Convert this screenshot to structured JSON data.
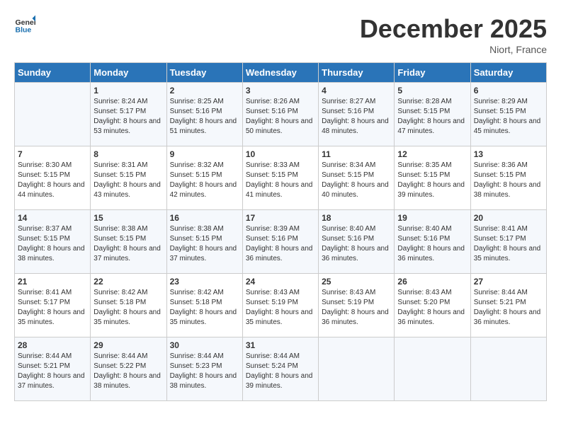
{
  "header": {
    "logo_general": "General",
    "logo_blue": "Blue",
    "month_title": "December 2025",
    "location": "Niort, France"
  },
  "days_of_week": [
    "Sunday",
    "Monday",
    "Tuesday",
    "Wednesday",
    "Thursday",
    "Friday",
    "Saturday"
  ],
  "weeks": [
    [
      {
        "day": "",
        "sunrise": "",
        "sunset": "",
        "daylight": ""
      },
      {
        "day": "1",
        "sunrise": "Sunrise: 8:24 AM",
        "sunset": "Sunset: 5:17 PM",
        "daylight": "Daylight: 8 hours and 53 minutes."
      },
      {
        "day": "2",
        "sunrise": "Sunrise: 8:25 AM",
        "sunset": "Sunset: 5:16 PM",
        "daylight": "Daylight: 8 hours and 51 minutes."
      },
      {
        "day": "3",
        "sunrise": "Sunrise: 8:26 AM",
        "sunset": "Sunset: 5:16 PM",
        "daylight": "Daylight: 8 hours and 50 minutes."
      },
      {
        "day": "4",
        "sunrise": "Sunrise: 8:27 AM",
        "sunset": "Sunset: 5:16 PM",
        "daylight": "Daylight: 8 hours and 48 minutes."
      },
      {
        "day": "5",
        "sunrise": "Sunrise: 8:28 AM",
        "sunset": "Sunset: 5:15 PM",
        "daylight": "Daylight: 8 hours and 47 minutes."
      },
      {
        "day": "6",
        "sunrise": "Sunrise: 8:29 AM",
        "sunset": "Sunset: 5:15 PM",
        "daylight": "Daylight: 8 hours and 45 minutes."
      }
    ],
    [
      {
        "day": "7",
        "sunrise": "Sunrise: 8:30 AM",
        "sunset": "Sunset: 5:15 PM",
        "daylight": "Daylight: 8 hours and 44 minutes."
      },
      {
        "day": "8",
        "sunrise": "Sunrise: 8:31 AM",
        "sunset": "Sunset: 5:15 PM",
        "daylight": "Daylight: 8 hours and 43 minutes."
      },
      {
        "day": "9",
        "sunrise": "Sunrise: 8:32 AM",
        "sunset": "Sunset: 5:15 PM",
        "daylight": "Daylight: 8 hours and 42 minutes."
      },
      {
        "day": "10",
        "sunrise": "Sunrise: 8:33 AM",
        "sunset": "Sunset: 5:15 PM",
        "daylight": "Daylight: 8 hours and 41 minutes."
      },
      {
        "day": "11",
        "sunrise": "Sunrise: 8:34 AM",
        "sunset": "Sunset: 5:15 PM",
        "daylight": "Daylight: 8 hours and 40 minutes."
      },
      {
        "day": "12",
        "sunrise": "Sunrise: 8:35 AM",
        "sunset": "Sunset: 5:15 PM",
        "daylight": "Daylight: 8 hours and 39 minutes."
      },
      {
        "day": "13",
        "sunrise": "Sunrise: 8:36 AM",
        "sunset": "Sunset: 5:15 PM",
        "daylight": "Daylight: 8 hours and 38 minutes."
      }
    ],
    [
      {
        "day": "14",
        "sunrise": "Sunrise: 8:37 AM",
        "sunset": "Sunset: 5:15 PM",
        "daylight": "Daylight: 8 hours and 38 minutes."
      },
      {
        "day": "15",
        "sunrise": "Sunrise: 8:38 AM",
        "sunset": "Sunset: 5:15 PM",
        "daylight": "Daylight: 8 hours and 37 minutes."
      },
      {
        "day": "16",
        "sunrise": "Sunrise: 8:38 AM",
        "sunset": "Sunset: 5:15 PM",
        "daylight": "Daylight: 8 hours and 37 minutes."
      },
      {
        "day": "17",
        "sunrise": "Sunrise: 8:39 AM",
        "sunset": "Sunset: 5:16 PM",
        "daylight": "Daylight: 8 hours and 36 minutes."
      },
      {
        "day": "18",
        "sunrise": "Sunrise: 8:40 AM",
        "sunset": "Sunset: 5:16 PM",
        "daylight": "Daylight: 8 hours and 36 minutes."
      },
      {
        "day": "19",
        "sunrise": "Sunrise: 8:40 AM",
        "sunset": "Sunset: 5:16 PM",
        "daylight": "Daylight: 8 hours and 36 minutes."
      },
      {
        "day": "20",
        "sunrise": "Sunrise: 8:41 AM",
        "sunset": "Sunset: 5:17 PM",
        "daylight": "Daylight: 8 hours and 35 minutes."
      }
    ],
    [
      {
        "day": "21",
        "sunrise": "Sunrise: 8:41 AM",
        "sunset": "Sunset: 5:17 PM",
        "daylight": "Daylight: 8 hours and 35 minutes."
      },
      {
        "day": "22",
        "sunrise": "Sunrise: 8:42 AM",
        "sunset": "Sunset: 5:18 PM",
        "daylight": "Daylight: 8 hours and 35 minutes."
      },
      {
        "day": "23",
        "sunrise": "Sunrise: 8:42 AM",
        "sunset": "Sunset: 5:18 PM",
        "daylight": "Daylight: 8 hours and 35 minutes."
      },
      {
        "day": "24",
        "sunrise": "Sunrise: 8:43 AM",
        "sunset": "Sunset: 5:19 PM",
        "daylight": "Daylight: 8 hours and 35 minutes."
      },
      {
        "day": "25",
        "sunrise": "Sunrise: 8:43 AM",
        "sunset": "Sunset: 5:19 PM",
        "daylight": "Daylight: 8 hours and 36 minutes."
      },
      {
        "day": "26",
        "sunrise": "Sunrise: 8:43 AM",
        "sunset": "Sunset: 5:20 PM",
        "daylight": "Daylight: 8 hours and 36 minutes."
      },
      {
        "day": "27",
        "sunrise": "Sunrise: 8:44 AM",
        "sunset": "Sunset: 5:21 PM",
        "daylight": "Daylight: 8 hours and 36 minutes."
      }
    ],
    [
      {
        "day": "28",
        "sunrise": "Sunrise: 8:44 AM",
        "sunset": "Sunset: 5:21 PM",
        "daylight": "Daylight: 8 hours and 37 minutes."
      },
      {
        "day": "29",
        "sunrise": "Sunrise: 8:44 AM",
        "sunset": "Sunset: 5:22 PM",
        "daylight": "Daylight: 8 hours and 38 minutes."
      },
      {
        "day": "30",
        "sunrise": "Sunrise: 8:44 AM",
        "sunset": "Sunset: 5:23 PM",
        "daylight": "Daylight: 8 hours and 38 minutes."
      },
      {
        "day": "31",
        "sunrise": "Sunrise: 8:44 AM",
        "sunset": "Sunset: 5:24 PM",
        "daylight": "Daylight: 8 hours and 39 minutes."
      },
      {
        "day": "",
        "sunrise": "",
        "sunset": "",
        "daylight": ""
      },
      {
        "day": "",
        "sunrise": "",
        "sunset": "",
        "daylight": ""
      },
      {
        "day": "",
        "sunrise": "",
        "sunset": "",
        "daylight": ""
      }
    ]
  ]
}
